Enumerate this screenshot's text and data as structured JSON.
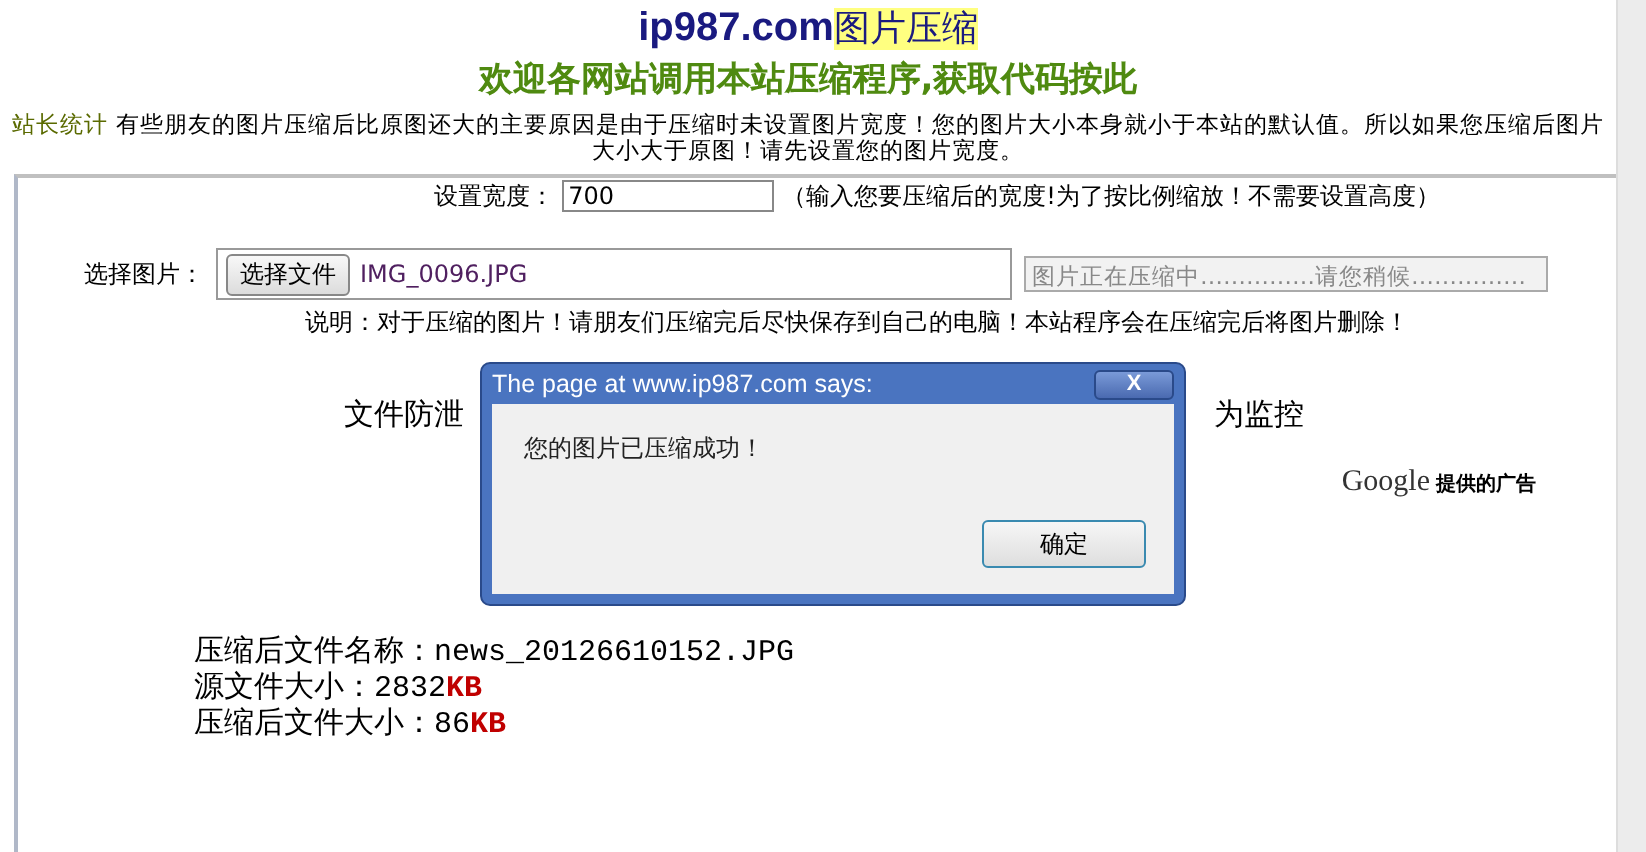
{
  "header": {
    "site": "ip987.com",
    "title": "图片压缩",
    "subtitle": "欢迎各网站调用本站压缩程序,获取代码按此"
  },
  "notice": {
    "link": "站长统计",
    "text": "有些朋友的图片压缩后比原图还大的主要原因是由于压缩时未设置图片宽度！您的图片大小本身就小于本站的默认值。所以如果您压缩后图片大小大于原图！请先设置您的图片宽度。"
  },
  "width_field": {
    "label": "设置宽度：",
    "value": "700",
    "hint": "（输入您要压缩后的宽度!为了按比例缩放！不需要设置高度）"
  },
  "file_field": {
    "label": "选择图片：",
    "button": "选择文件",
    "file_name": "IMG_0096.JPG",
    "status": "图片正在压缩中……………请您稍候……………"
  },
  "note": "说明：对于压缩的图片！请朋友们压缩完后尽快保存到自己的电脑！本站程序会在压缩完后将图片删除！",
  "ad": {
    "left_text": "文件防泄",
    "right_text": "为监控",
    "brand": "Google",
    "attribution": "提供的广告"
  },
  "results": [
    {
      "label": "压缩后文件名称：",
      "value": "news_20126610152.JPG"
    },
    {
      "label": "源文件大小：",
      "value": "2832",
      "unit": "KB"
    },
    {
      "label": "压缩后文件大小：",
      "value": "86",
      "unit": "KB"
    }
  ],
  "dialog": {
    "title": "The page at www.ip987.com says:",
    "close": "X",
    "message": "您的图片已压缩成功！",
    "ok_button": "确定"
  }
}
